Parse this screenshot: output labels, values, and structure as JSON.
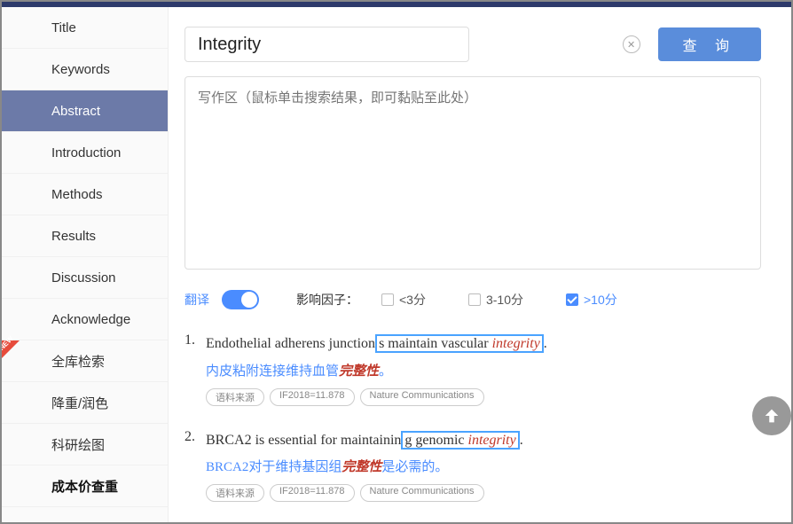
{
  "sidebar": {
    "items": [
      {
        "label": "Title"
      },
      {
        "label": "Keywords"
      },
      {
        "label": "Abstract"
      },
      {
        "label": "Introduction"
      },
      {
        "label": "Methods"
      },
      {
        "label": "Results"
      },
      {
        "label": "Discussion"
      },
      {
        "label": "Acknowledge"
      },
      {
        "label": "全库检索",
        "new": true
      },
      {
        "label": "降重/润色"
      },
      {
        "label": "科研绘图"
      },
      {
        "label": "成本价查重",
        "bold": true
      }
    ],
    "new_badge": "NEW"
  },
  "search": {
    "value": "Integrity",
    "query_button": "查 询"
  },
  "writing": {
    "placeholder": "写作区（鼠标单击搜索结果，即可黏贴至此处）"
  },
  "filters": {
    "translate_label": "翻译",
    "if_label": "影响因子：",
    "opt1": "<3分",
    "opt2": "3-10分",
    "opt3": ">10分"
  },
  "results": [
    {
      "num": "1.",
      "en_pre": "Endothelial adherens junction",
      "en_box": "s maintain vascular ",
      "en_hl": "integrity",
      "en_post": ".",
      "zh_pre": "内皮粘附连接维持血管",
      "zh_hl": "完整性",
      "zh_post": "。",
      "tag1": "语料来源",
      "tag2": "IF2018=11.878",
      "tag3": "Nature Communications"
    },
    {
      "num": "2.",
      "en_pre": "BRCA2 is essential for maintainin",
      "en_box": "g genomic ",
      "en_hl": "integrity",
      "en_post": ".",
      "zh_pre": "BRCA2对于维持基因组",
      "zh_hl": "完整性",
      "zh_post": "是必需的。",
      "tag1": "语料来源",
      "tag2": "IF2018=11.878",
      "tag3": "Nature Communications"
    }
  ]
}
